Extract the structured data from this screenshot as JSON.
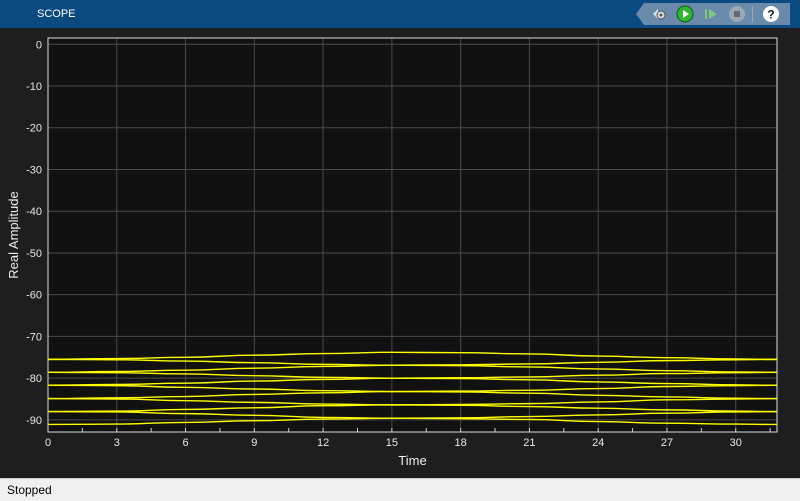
{
  "window": {
    "title": "SCOPE"
  },
  "toolbar": {
    "buttons": [
      {
        "icon": "settings-gear-icon"
      },
      {
        "icon": "run-icon"
      },
      {
        "icon": "step-forward-icon"
      },
      {
        "icon": "stop-icon"
      },
      {
        "icon": "help-icon"
      }
    ]
  },
  "status": {
    "text": "Stopped"
  },
  "colors": {
    "trace": "#ffff00",
    "plot_bg": "#111111",
    "grid": "#4a4a4a",
    "titlebar": "#0b4a80"
  },
  "chart_data": {
    "type": "line",
    "xlabel": "Time",
    "ylabel": "Real Amplitude",
    "xlim": [
      0,
      31.8
    ],
    "ylim": [
      -92.9,
      1.5
    ],
    "xticks": [
      0,
      3,
      6,
      9,
      12,
      15,
      18,
      21,
      24,
      27,
      30
    ],
    "yticks": [
      0,
      -10,
      -20,
      -30,
      -40,
      -50,
      -60,
      -70,
      -80,
      -90
    ],
    "grid": true,
    "x": [
      0,
      3,
      6,
      9,
      12,
      15,
      18,
      21,
      24,
      27,
      30,
      31.8
    ],
    "series": [
      {
        "values": [
          -75.5,
          -75.3,
          -75.0,
          -74.5,
          -74.1,
          -73.8,
          -73.9,
          -74.2,
          -74.7,
          -75.1,
          -75.4,
          -75.5
        ]
      },
      {
        "values": [
          -75.5,
          -75.6,
          -75.9,
          -76.3,
          -76.7,
          -76.9,
          -76.8,
          -76.6,
          -76.2,
          -75.8,
          -75.6,
          -75.5
        ]
      },
      {
        "values": [
          -78.6,
          -78.4,
          -78.1,
          -77.6,
          -77.2,
          -76.9,
          -77.0,
          -77.3,
          -77.8,
          -78.2,
          -78.5,
          -78.6
        ]
      },
      {
        "values": [
          -78.6,
          -78.7,
          -79.0,
          -79.4,
          -79.8,
          -80.0,
          -79.9,
          -79.7,
          -79.3,
          -78.9,
          -78.7,
          -78.6
        ]
      },
      {
        "values": [
          -81.7,
          -81.5,
          -81.2,
          -80.7,
          -80.3,
          -80.0,
          -80.1,
          -80.4,
          -80.9,
          -81.3,
          -81.6,
          -81.7
        ]
      },
      {
        "values": [
          -81.7,
          -81.8,
          -82.2,
          -82.6,
          -83.0,
          -83.2,
          -83.1,
          -82.9,
          -82.5,
          -82.0,
          -81.8,
          -81.7
        ]
      },
      {
        "values": [
          -84.9,
          -84.7,
          -84.4,
          -83.9,
          -83.5,
          -83.2,
          -83.3,
          -83.6,
          -84.1,
          -84.5,
          -84.8,
          -84.9
        ]
      },
      {
        "values": [
          -84.9,
          -85.0,
          -85.4,
          -85.8,
          -86.2,
          -86.4,
          -86.3,
          -86.1,
          -85.7,
          -85.2,
          -85.0,
          -84.9
        ]
      },
      {
        "values": [
          -88.0,
          -87.9,
          -87.5,
          -87.1,
          -86.6,
          -86.4,
          -86.5,
          -86.8,
          -87.2,
          -87.6,
          -87.9,
          -88.0
        ]
      },
      {
        "values": [
          -88.0,
          -88.1,
          -88.5,
          -88.9,
          -89.4,
          -89.6,
          -89.5,
          -89.2,
          -88.8,
          -88.4,
          -88.1,
          -88.0
        ]
      },
      {
        "values": [
          -91.1,
          -91.0,
          -90.6,
          -90.2,
          -89.8,
          -89.6,
          -89.7,
          -89.9,
          -90.4,
          -90.8,
          -91.0,
          -91.1
        ]
      }
    ]
  }
}
